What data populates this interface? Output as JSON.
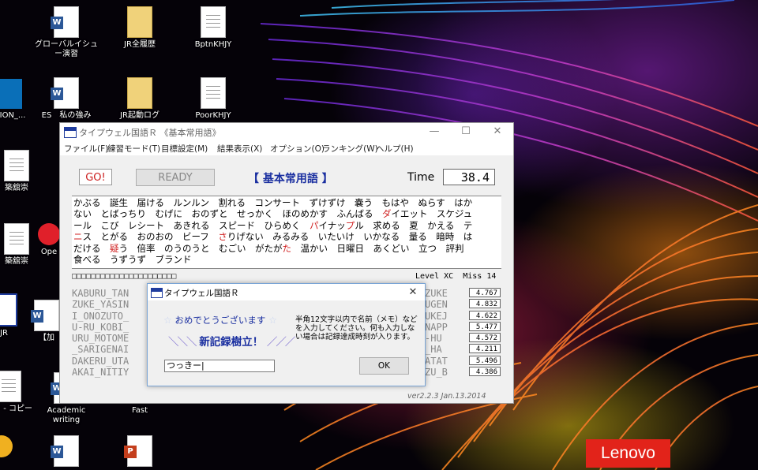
{
  "desktop": {
    "icons": [
      {
        "label": "グローバルイシュー演習",
        "type": "word"
      },
      {
        "label": "JR全履歴",
        "type": "folder"
      },
      {
        "label": "BptnKHJY",
        "type": "doc"
      },
      {
        "label": "TION_...",
        "type": "app"
      },
      {
        "label": "ES　私の強み",
        "type": "word"
      },
      {
        "label": "JR起動ログ",
        "type": "folder"
      },
      {
        "label": "PoorKHJY",
        "type": "doc"
      },
      {
        "label": "築舘崇",
        "type": "doc"
      },
      {
        "label": "築舘崇",
        "type": "doc"
      },
      {
        "label": "Ope",
        "type": "app"
      },
      {
        "label": "JR",
        "type": "app"
      },
      {
        "label": "【加",
        "type": "word"
      },
      {
        "label": "ダー - コピー",
        "type": "doc"
      },
      {
        "label": "Academic writing",
        "type": "word"
      },
      {
        "label": "Fast",
        "type": "doc"
      }
    ],
    "brand": "Lenovo"
  },
  "main_window": {
    "title": "タイプウェル国語Ｒ 《基本常用語》",
    "menu": [
      "ファイル(F)",
      "練習モード(T)",
      "目標設定(M)",
      "結果表示(X)",
      "オプション(O)",
      "ランキング(W)",
      "ヘルプ(H)"
    ],
    "go_label": "GO!",
    "ready_label": "READY",
    "course_title": "【 基本常用語 】",
    "time_label": "Time",
    "time_value": "38.4",
    "text_lines": [
      [
        "かぶる　誕生　届ける　ルンルン　割れる　コンサート　ずけずけ　嚢う　もはや　ぬらす　はか"
      ],
      [
        "ない　とばっちり　むげに　おのずと　せっかく　ほのめかす　ふんばる　",
        {
          "r": "ダ"
        },
        "イエット　スケジュ"
      ],
      [
        "ール　こび　レシート　あきれる　スピード　ひらめく　",
        {
          "r": "パ"
        },
        "イナッ",
        {
          "r": "プ"
        },
        "ル　求める　夏　かえる　テ"
      ],
      [
        {
          "r": "ニ"
        },
        "ス　とがる　おのおの　ビーフ　",
        {
          "r": "さ"
        },
        "りげない　みるみる　いたいけ　いかなる　量る　暗時　は"
      ],
      [
        "だける　",
        {
          "r": "疑"
        },
        "う　倍率　のうのうと　むごい　がたが",
        {
          "r": "た"
        },
        "　温かい　日曜日　あくどい　立つ　評判"
      ],
      [
        "食べる　うずうず　ブランド"
      ]
    ],
    "progress_boxes": "□□□□□□□□□□□□□□□□□□□□□□",
    "level_text": "Level XC",
    "miss_text": "Miss 14",
    "history_left": [
      "KABURU_TAN",
      "ZUKE_YASIN",
      "I_ONOZUTO_",
      "U-RU_KOBI_",
      "URU_MOTOME",
      "_SARIGENAI",
      "DAKERU_UTA",
      "AKAI_NITIY"
    ],
    "history_right": [
      "ZUKE",
      "UGEN",
      "UKEJ",
      "NAPP",
      "-HU",
      "_HA",
      "ATAT",
      "ZU_B"
    ],
    "scores": [
      "4.767",
      "4.832",
      "4.622",
      "5.477",
      "4.572",
      "4.211",
      "5.496",
      "4.386"
    ],
    "version": "ver2.2.3 Jan.13.2014"
  },
  "dialog": {
    "title": "タイプウェル国語Ｒ",
    "congrats": "おめでとうございます",
    "record": "新記録樹立！",
    "instructions": "半角12文字以内で名前（メモ）などを入力してください。何も入力しない場合は記録達成時刻が入ります。",
    "name_value": "つっきー|",
    "ok_label": "OK"
  },
  "colors": {
    "title_blue": "#1a2fa0",
    "accent_red": "#d02020",
    "lenovo_red": "#e2231a"
  }
}
